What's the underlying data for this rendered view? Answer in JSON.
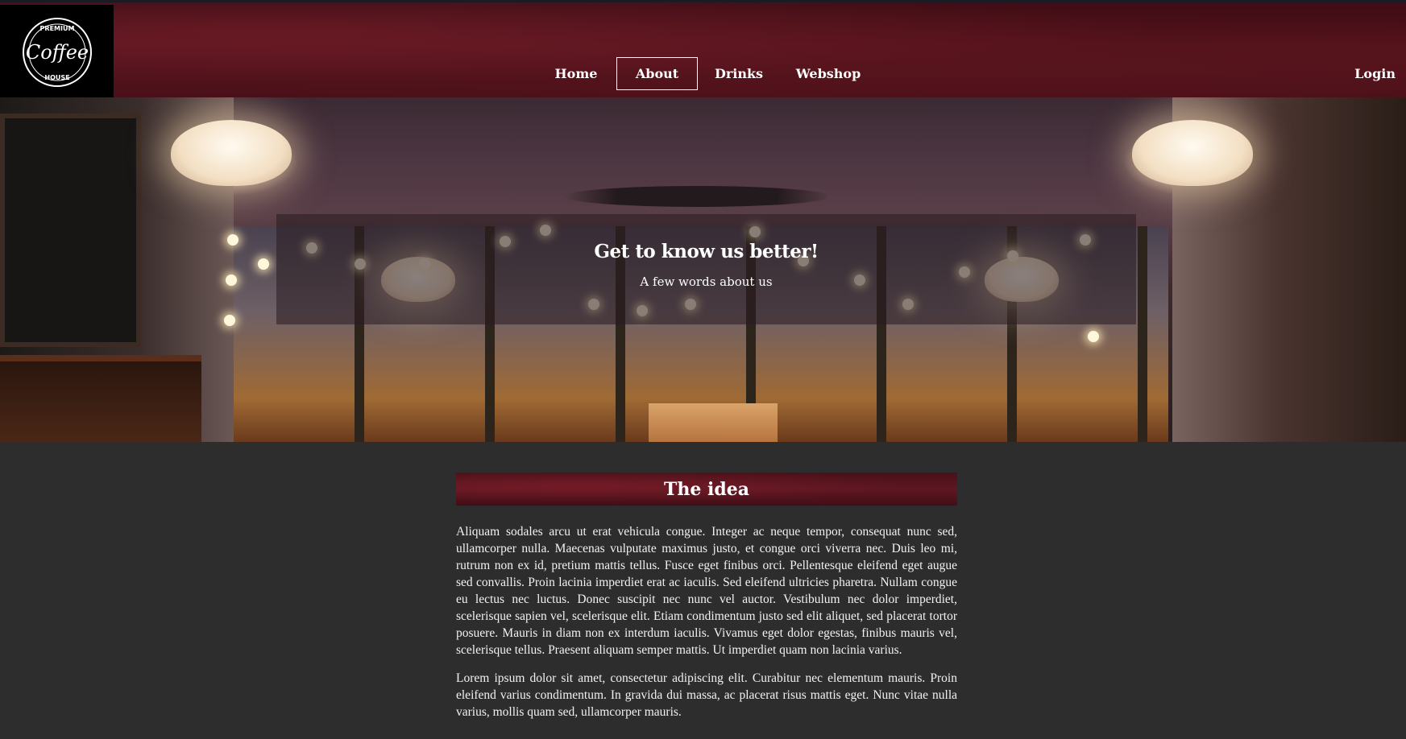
{
  "logo": {
    "top_text": "PREMIUM",
    "main_text": "Coffee",
    "bottom_text": "HOUSE"
  },
  "nav": {
    "items": [
      {
        "label": "Home",
        "active": false
      },
      {
        "label": "About",
        "active": true
      },
      {
        "label": "Drinks",
        "active": false
      },
      {
        "label": "Webshop",
        "active": false
      }
    ],
    "login_label": "Login"
  },
  "hero": {
    "title": "Get to know us better!",
    "subtitle": "A few words about us"
  },
  "main": {
    "section_title": "The idea",
    "paragraphs": [
      "Aliquam sodales arcu ut erat vehicula congue. Integer ac neque tempor, consequat nunc sed, ullamcorper nulla. Maecenas vulputate maximus justo, et congue orci viverra nec. Duis leo mi, rutrum non ex id, pretium mattis tellus. Fusce eget finibus orci. Pellentesque eleifend eget augue sed convallis. Proin lacinia imperdiet erat ac iaculis. Sed eleifend ultricies pharetra. Nullam congue eu lectus nec luctus. Donec suscipit nec nunc vel auctor. Vestibulum nec dolor imperdiet, scelerisque sapien vel, scelerisque elit. Etiam condimentum justo sed elit aliquet, sed placerat tortor posuere. Mauris in diam non ex interdum iaculis. Vivamus eget dolor egestas, finibus mauris vel, scelerisque tellus. Praesent aliquam semper mattis. Ut imperdiet quam non lacinia varius.",
      "Lorem ipsum dolor sit amet, consectetur adipiscing elit. Curabitur nec elementum mauris. Proin eleifend varius condimentum. In gravida dui massa, ac placerat risus mattis eget. Nunc vitae nulla varius, mollis quam sed, ullamcorper mauris."
    ]
  },
  "colors": {
    "header_maroon": "#5a1620",
    "page_background": "#2d2d2d",
    "text": "#ffffff"
  }
}
